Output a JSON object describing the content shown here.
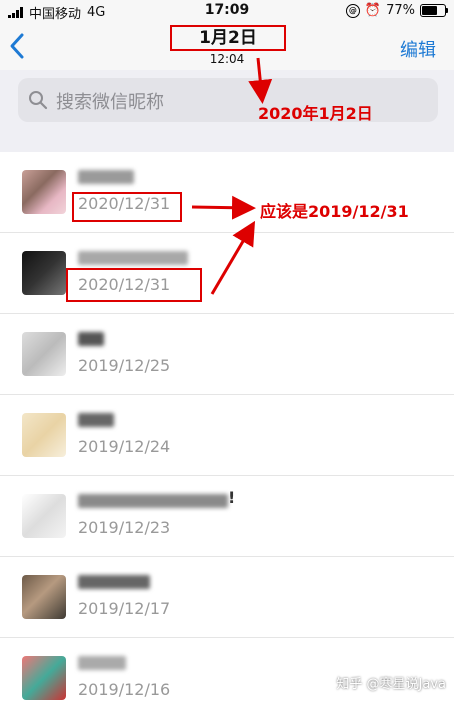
{
  "status_bar": {
    "carrier": "中国移动",
    "network": "4G",
    "time": "17:09",
    "battery": "77%",
    "battery_level": 0.77
  },
  "nav": {
    "title": "1月2日",
    "subtitle": "12:04",
    "edit_label": "编辑"
  },
  "search": {
    "placeholder": "搜索微信昵称"
  },
  "list": {
    "items": [
      {
        "date": "2020/12/31"
      },
      {
        "date": "2020/12/31"
      },
      {
        "date": "2019/12/25"
      },
      {
        "date": "2019/12/24"
      },
      {
        "date": "2019/12/23",
        "name_suffix": "!"
      },
      {
        "date": "2019/12/17"
      },
      {
        "date": "2019/12/16"
      }
    ]
  },
  "annotations": {
    "actual_date": "2020年1月2日",
    "should_be": "应该是2019/12/31"
  },
  "watermark": "知乎 @寒星说Java",
  "colors": {
    "accent": "#1e7ad4",
    "annotation": "#dd0000"
  }
}
